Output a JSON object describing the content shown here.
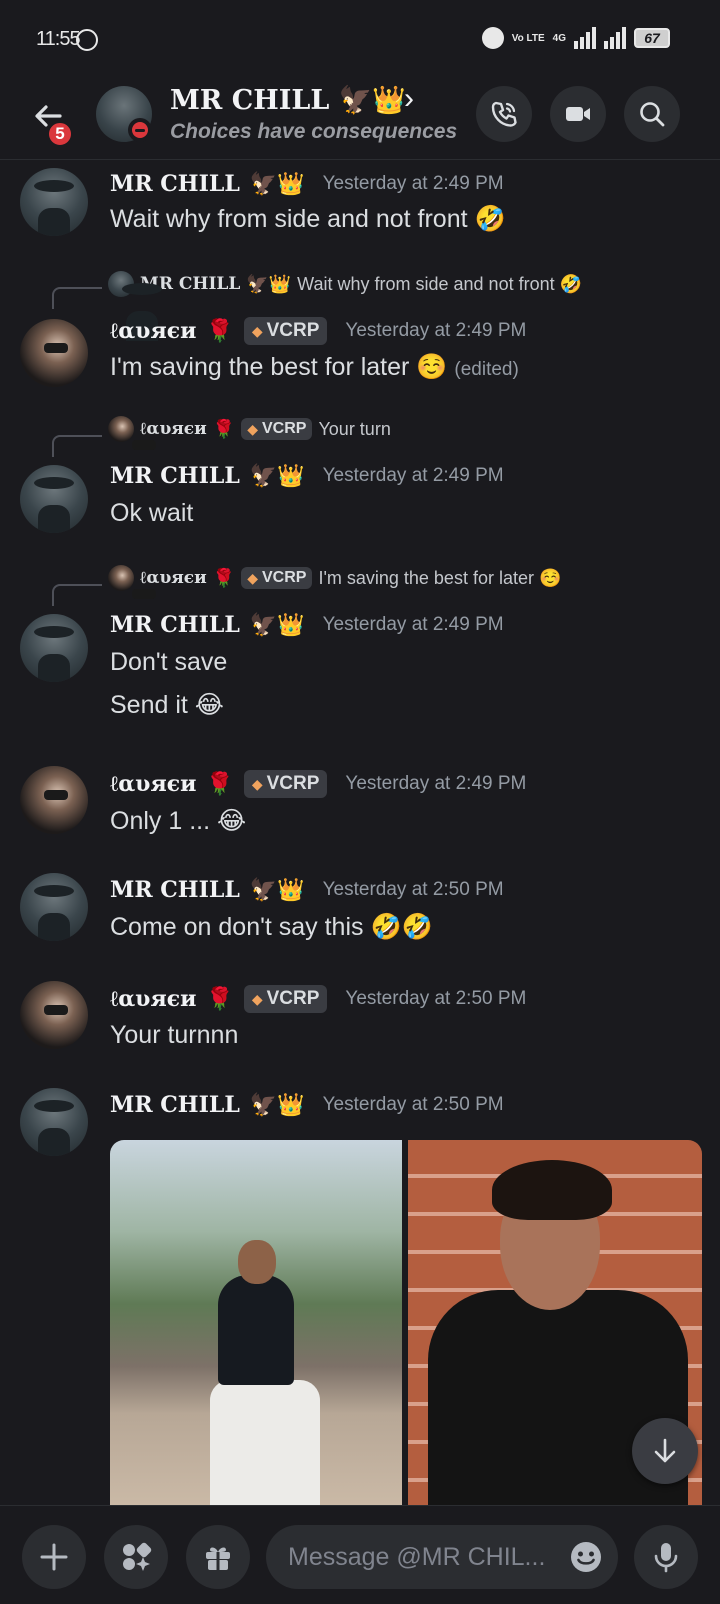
{
  "status_bar": {
    "time": "11:55",
    "network_label": "Vo LTE",
    "signal_label": "4G",
    "battery": "67"
  },
  "header": {
    "back_badge": "5",
    "name": "MR CHILL",
    "name_emojis": "🦅👑",
    "chevron": "›",
    "status": "Choices have consequences"
  },
  "messages": [
    {
      "author": "MR CHILL",
      "author_emojis": "🦅👑",
      "tag": "",
      "timestamp": "Yesterday at 2:49 PM",
      "lines": [
        "Wait why from side and not front 🤣"
      ]
    },
    {
      "reply": {
        "name": "MR CHILL",
        "emojis": "🦅👑",
        "tag": "",
        "text": "Wait why from side and not front 🤣"
      },
      "author": "ℓαυяєи",
      "author_emojis": "🌹",
      "tag": "VCRP",
      "timestamp": "Yesterday at 2:49 PM",
      "lines": [
        "I'm saving the best for later ☺️"
      ],
      "edited": "(edited)"
    },
    {
      "reply": {
        "name": "ℓαυяєи",
        "emojis": "🌹",
        "tag": "VCRP",
        "text": "Your turn"
      },
      "author": "MR CHILL",
      "author_emojis": "🦅👑",
      "tag": "",
      "timestamp": "Yesterday at 2:49 PM",
      "lines": [
        "Ok wait"
      ]
    },
    {
      "reply": {
        "name": "ℓαυяєи",
        "emojis": "🌹",
        "tag": "VCRP",
        "text": "I'm saving the best for later ☺️"
      },
      "author": "MR CHILL",
      "author_emojis": "🦅👑",
      "tag": "",
      "timestamp": "Yesterday at 2:49 PM",
      "lines": [
        "Don't save",
        "Send it 😂"
      ]
    },
    {
      "author": "ℓαυяєи",
      "author_emojis": "🌹",
      "tag": "VCRP",
      "timestamp": "Yesterday at 2:49 PM",
      "lines": [
        "Only 1 ... 😂"
      ]
    },
    {
      "author": "MR CHILL",
      "author_emojis": "🦅👑",
      "tag": "",
      "timestamp": "Yesterday at 2:50 PM",
      "lines": [
        "Come on don't say this 🤣🤣"
      ]
    },
    {
      "author": "ℓαυяєи",
      "author_emojis": "🌹",
      "tag": "VCRP",
      "timestamp": "Yesterday at 2:50 PM",
      "lines": [
        "Your turnnn"
      ]
    },
    {
      "author": "MR CHILL",
      "author_emojis": "🦅👑",
      "tag": "",
      "timestamp": "Yesterday at 2:50 PM",
      "lines": [],
      "attachments": 2
    }
  ],
  "composer": {
    "placeholder": "Message @MR CHIL..."
  },
  "colors": {
    "background": "#1a1a1e",
    "surface": "#2b2d31",
    "dnd_red": "#da373c",
    "text": "#dbdee1",
    "muted": "#949ba4"
  },
  "icons": [
    "back-arrow-icon",
    "voice-call-icon",
    "video-call-icon",
    "search-icon",
    "plus-icon",
    "apps-icon",
    "gift-icon",
    "emoji-icon",
    "microphone-icon",
    "arrow-down-icon"
  ]
}
